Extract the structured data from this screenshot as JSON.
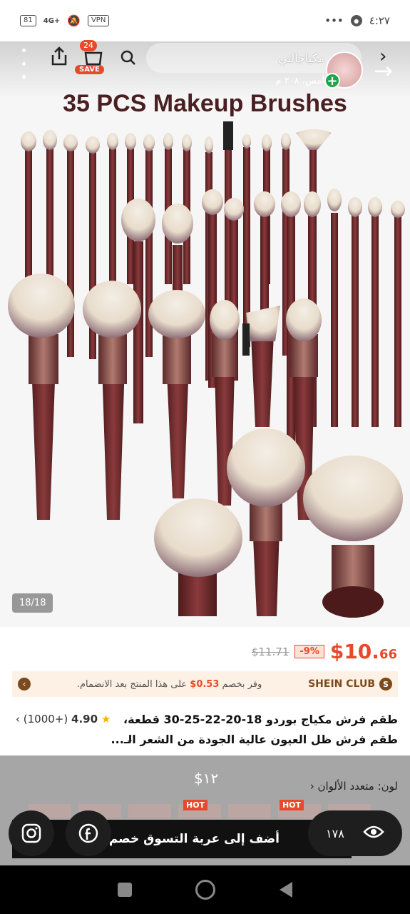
{
  "status_bar": {
    "left_badge": "81",
    "signal": "4G+",
    "vpn": "VPN",
    "time": "٤:٢٧",
    "dots": "•••"
  },
  "hero": {
    "title": "35 PCS Makeup Brushes",
    "counter": "18/18"
  },
  "header": {
    "cart_count": "24",
    "save_label": "SAVE",
    "store_name": "مكياجالتي",
    "store_sub": "أمس، ٢٠٨ م"
  },
  "price": {
    "current_major": "$10.",
    "current_minor": "66",
    "discount": "-9%",
    "original": "$11.71"
  },
  "club": {
    "brand": "SHEIN CLUB",
    "text_prefix": "وفر بخصم ",
    "amount": "0.53$",
    "text_suffix": " على هذا المنتج بعد الانضمام."
  },
  "product": {
    "title_line1": "طقم فرش مكياج بوردو 18-20-22-25-30 قطعة،",
    "title_line2": "طقم فرش ظل العيون عالية الجودة من الشعر الـ...",
    "rating": "4.90",
    "reviews": "(1000+)"
  },
  "options": {
    "price": "$١٢",
    "color_label": "لون: متعدد الألوان",
    "hot": "HOT"
  },
  "cta": {
    "add_to_cart": "أضف إلى عربة التسوق خصم 9%"
  },
  "social": {
    "views": "١٧٨"
  },
  "colors": {
    "accent": "#e8492a",
    "brush_handle": "#6e2a2c",
    "club_brown": "#7a4a1d"
  }
}
